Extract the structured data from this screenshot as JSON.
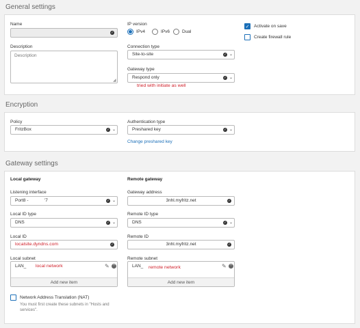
{
  "sections": {
    "general": "General settings",
    "encryption": "Encryption",
    "gateway": "Gateway settings"
  },
  "general": {
    "name_label": "Name",
    "name_value": "",
    "description_label": "Description",
    "description_placeholder": "Description",
    "ip_version_label": "IP version",
    "ip_options": [
      "IPv4",
      "IPv6",
      "Dual"
    ],
    "ip_selected": "IPv4",
    "connection_type_label": "Connection type",
    "connection_type_value": "Site-to-site",
    "gateway_type_label": "Gateway type",
    "gateway_type_value": "Respond only",
    "gateway_type_annotation": "tried with initiate as well",
    "activate_on_save_label": "Activate on save",
    "activate_on_save_checked": true,
    "create_firewall_rule_label": "Create firewall rule",
    "create_firewall_rule_checked": false
  },
  "encryption": {
    "policy_label": "Policy",
    "policy_value": "FritzBox",
    "auth_type_label": "Authentication type",
    "auth_type_value": "Preshared key",
    "change_key_link": "Change preshared key"
  },
  "gateway": {
    "local_heading": "Local gateway",
    "remote_heading": "Remote gateway",
    "listening_interface_label": "Listening interface",
    "listening_interface_value": "Port8 -             '7",
    "gateway_address_label": "Gateway address",
    "gateway_address_value": "3nhl.myfritz.net",
    "local_id_type_label": "Local ID type",
    "local_id_type_value": "DNS",
    "remote_id_type_label": "Remote ID type",
    "remote_id_type_value": "DNS",
    "local_id_label": "Local ID",
    "local_id_value": "localsite.dyndns.com",
    "remote_id_label": "Remote ID",
    "remote_id_value": "3nhl.myfritz.net",
    "local_subnet_label": "Local subnet",
    "local_subnet_value": "LAN_",
    "local_subnet_annotation": "local network",
    "remote_subnet_label": "Remote subnet",
    "remote_subnet_value": "LAN_",
    "remote_subnet_annotation": "remote network",
    "add_new_item": "Add new item",
    "nat_label": "Network Address Translation (NAT)",
    "nat_checked": false,
    "nat_note": "You must first create these subnets in \"Hosts and services\"."
  },
  "colors": {
    "accent": "#1b6fb8",
    "annotation_red": "#d0202a",
    "background": "#f2f2f2"
  },
  "icons": [
    "check-circle-icon",
    "chevron-down-icon",
    "pencil-icon",
    "minus-circle-icon",
    "checkbox-icon",
    "radio-icon",
    "resize-grip-icon"
  ]
}
